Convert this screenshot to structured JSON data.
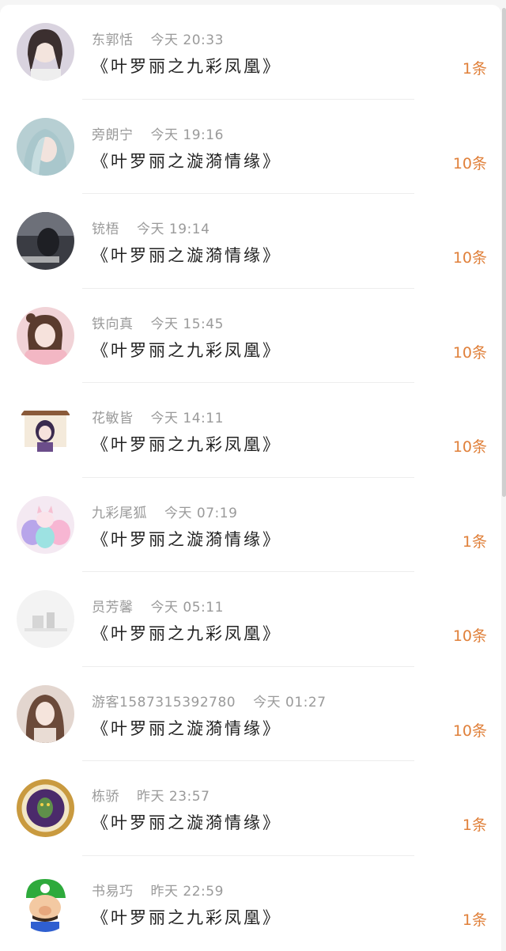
{
  "messages": [
    {
      "name": "东郭恬",
      "time": "今天 20:33",
      "title": "《叶罗丽之九彩凤凰》",
      "count": "1条",
      "avatar_color": "#d9d3df"
    },
    {
      "name": "旁朗宁",
      "time": "今天 19:16",
      "title": "《叶罗丽之漩漪情缘》",
      "count": "10条",
      "avatar_color": "#b7cfd3"
    },
    {
      "name": "铳梧",
      "time": "今天 19:14",
      "title": "《叶罗丽之漩漪情缘》",
      "count": "10条",
      "avatar_color": "#3a3c43"
    },
    {
      "name": "铁向真",
      "time": "今天 15:45",
      "title": "《叶罗丽之九彩凤凰》",
      "count": "10条",
      "avatar_color": "#f1d3d7"
    },
    {
      "name": "花敏皆",
      "time": "今天 14:11",
      "title": "《叶罗丽之九彩凤凰》",
      "count": "10条",
      "avatar_color": "#ffffff"
    },
    {
      "name": "九彩尾狐",
      "time": "今天 07:19",
      "title": "《叶罗丽之漩漪情缘》",
      "count": "1条",
      "avatar_color": "#f4e9f2"
    },
    {
      "name": "员芳馨",
      "time": "今天 05:11",
      "title": "《叶罗丽之九彩凤凰》",
      "count": "10条",
      "avatar_color": "#f3f3f3"
    },
    {
      "name": "游客1587315392780",
      "time": "今天 01:27",
      "title": "《叶罗丽之漩漪情缘》",
      "count": "10条",
      "avatar_color": "#e3d6cf"
    },
    {
      "name": "栋骄",
      "time": "昨天 23:57",
      "title": "《叶罗丽之漩漪情缘》",
      "count": "1条",
      "avatar_color": "#c99a3f"
    },
    {
      "name": "书易巧",
      "time": "昨天 22:59",
      "title": "《叶罗丽之九彩凤凰》",
      "count": "1条",
      "avatar_color": "#ffffff"
    }
  ],
  "colors": {
    "count_accent": "#e0803a",
    "meta_text": "#9a9a9a",
    "title_text": "#222222"
  }
}
